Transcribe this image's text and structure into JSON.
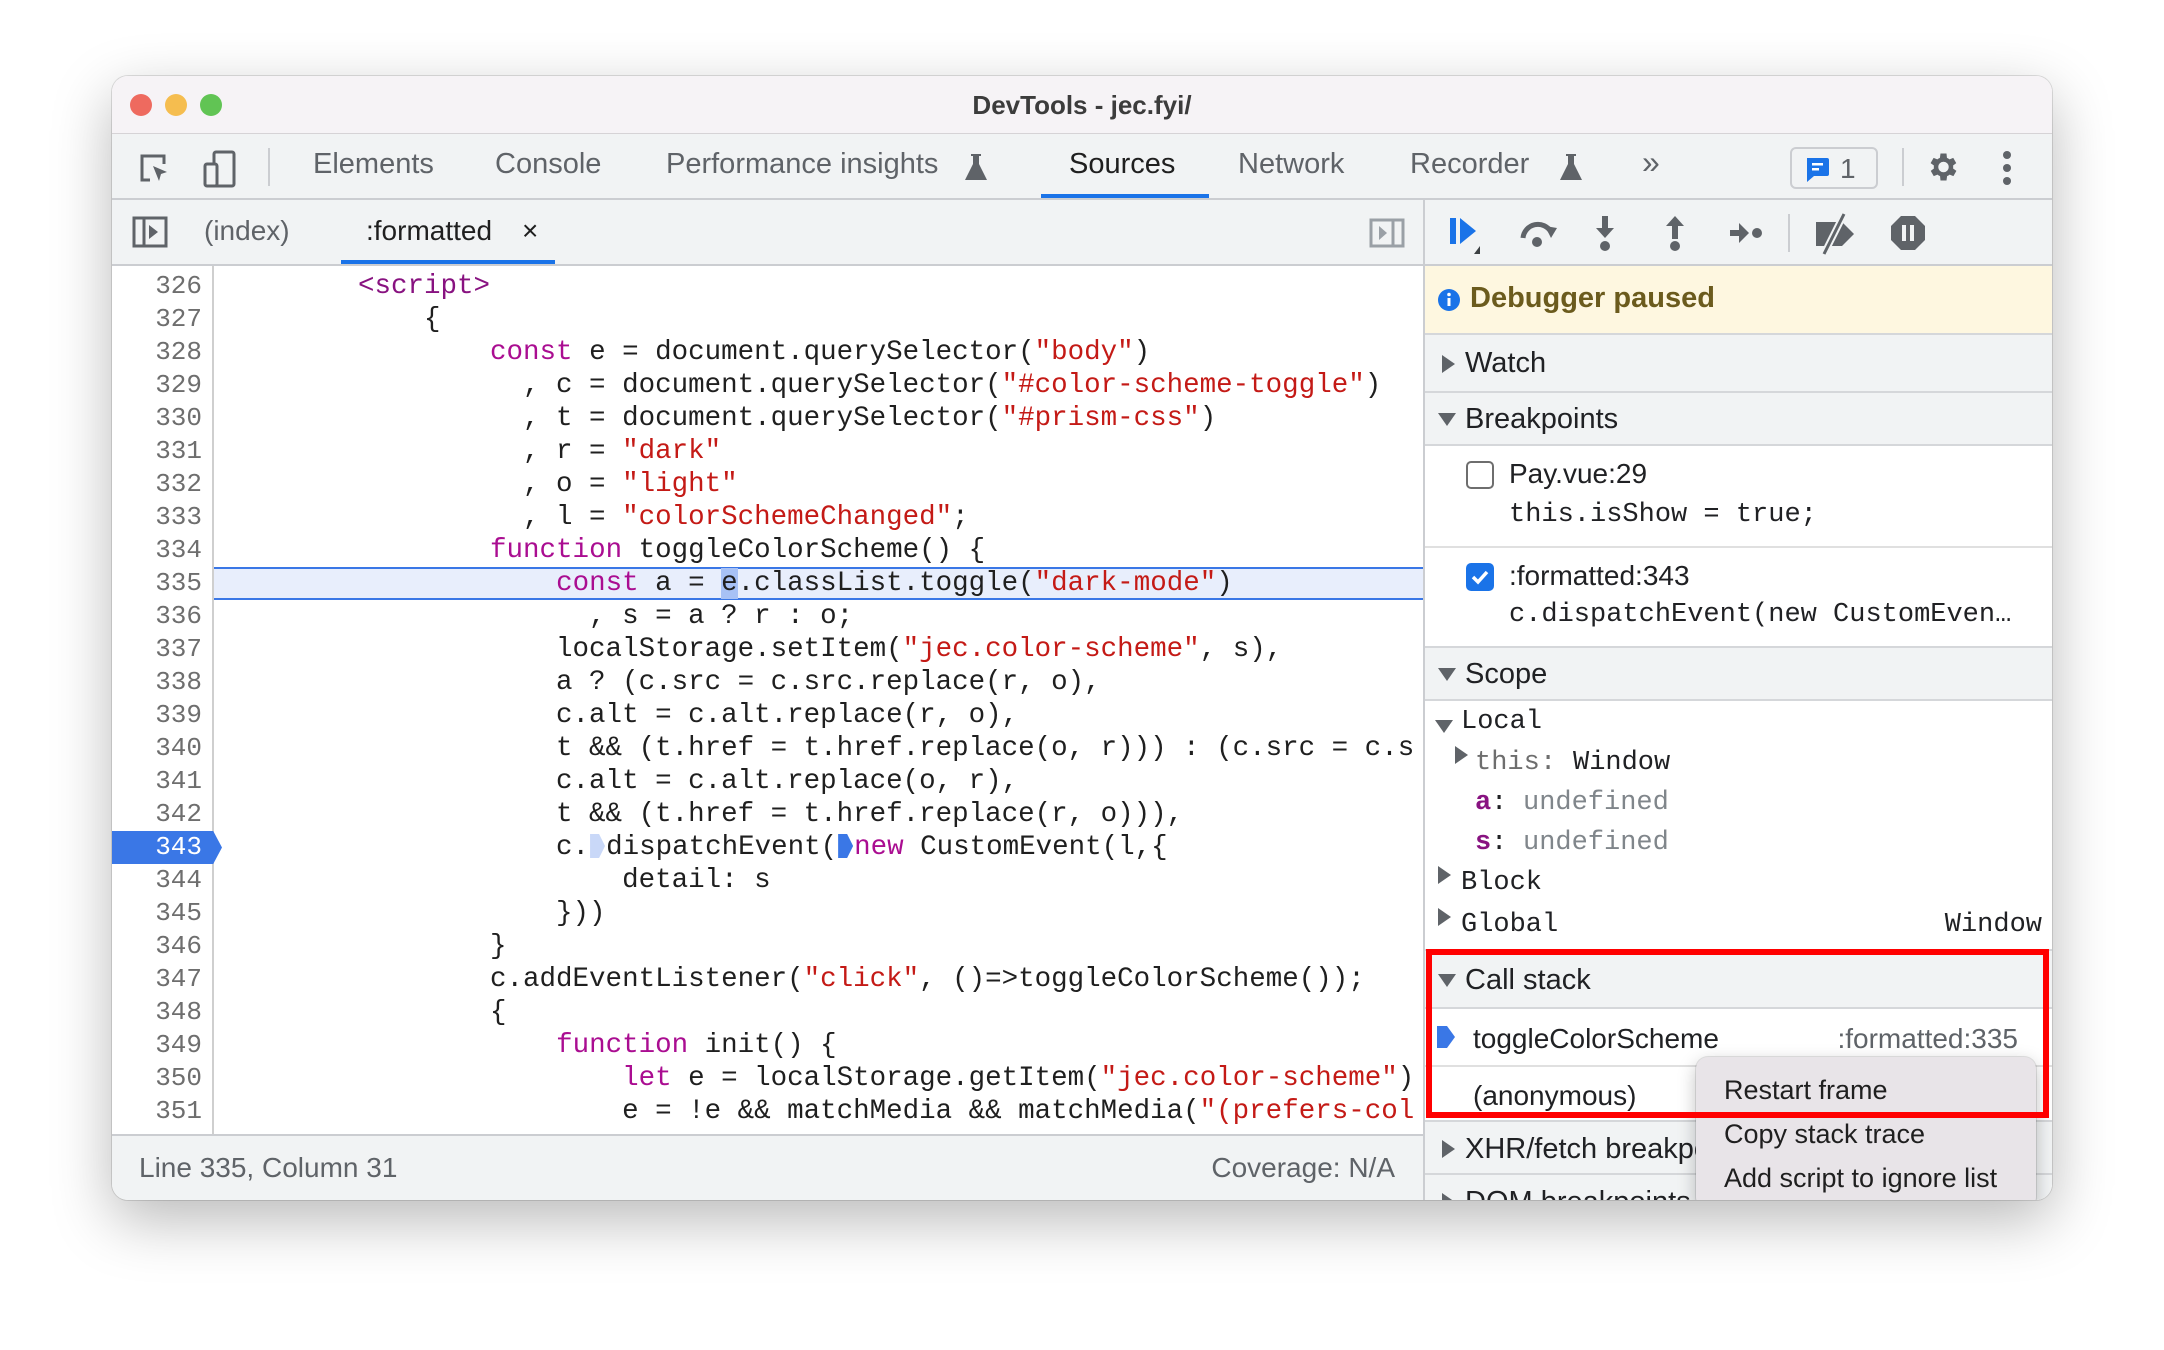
{
  "window": {
    "title": "DevTools - jec.fyi/"
  },
  "toolbar": {
    "tabs": [
      {
        "label": "Elements"
      },
      {
        "label": "Console"
      },
      {
        "label": "Performance insights",
        "icon": "flask-icon"
      },
      {
        "label": "Sources",
        "active": true
      },
      {
        "label": "Network"
      },
      {
        "label": "Recorder",
        "icon": "flask-icon"
      }
    ],
    "more_tabs": "»",
    "issues_count": "1"
  },
  "file_tabs": {
    "items": [
      {
        "label": "(index)"
      },
      {
        "label": ":formatted",
        "active": true
      }
    ],
    "close": "×"
  },
  "editor": {
    "current_line": 335,
    "paused_line": 343,
    "lines": [
      {
        "num": "326",
        "tokens": [
          [
            "t",
            "        "
          ],
          [
            "tg",
            "<script>"
          ]
        ]
      },
      {
        "num": "327",
        "tokens": [
          [
            "t",
            "            {"
          ]
        ]
      },
      {
        "num": "328",
        "tokens": [
          [
            "t",
            "                "
          ],
          [
            "k",
            "const"
          ],
          [
            "t",
            " e = document.querySelector("
          ],
          [
            "s",
            "\"body\""
          ],
          [
            "t",
            ")"
          ]
        ]
      },
      {
        "num": "329",
        "tokens": [
          [
            "t",
            "                  , c = document.querySelector("
          ],
          [
            "s",
            "\"#color-scheme-toggle\""
          ],
          [
            "t",
            ")"
          ]
        ]
      },
      {
        "num": "330",
        "tokens": [
          [
            "t",
            "                  , t = document.querySelector("
          ],
          [
            "s",
            "\"#prism-css\""
          ],
          [
            "t",
            ")"
          ]
        ]
      },
      {
        "num": "331",
        "tokens": [
          [
            "t",
            "                  , r = "
          ],
          [
            "s",
            "\"dark\""
          ]
        ]
      },
      {
        "num": "332",
        "tokens": [
          [
            "t",
            "                  , o = "
          ],
          [
            "s",
            "\"light\""
          ]
        ]
      },
      {
        "num": "333",
        "tokens": [
          [
            "t",
            "                  , l = "
          ],
          [
            "s",
            "\"colorSchemeChanged\""
          ],
          [
            "t",
            ";"
          ]
        ]
      },
      {
        "num": "334",
        "tokens": [
          [
            "t",
            "                "
          ],
          [
            "k",
            "function"
          ],
          [
            "t",
            " toggleColorScheme() {"
          ]
        ]
      },
      {
        "num": "335",
        "tokens": [
          [
            "t",
            "                    "
          ],
          [
            "k",
            "const"
          ],
          [
            "t",
            " a = "
          ],
          [
            "sel",
            "e"
          ],
          [
            "t",
            ".classList.toggle("
          ],
          [
            "s",
            "\"dark-mode\""
          ],
          [
            "t",
            ")"
          ]
        ]
      },
      {
        "num": "336",
        "tokens": [
          [
            "t",
            "                      , s = a ? r : o;"
          ]
        ]
      },
      {
        "num": "337",
        "tokens": [
          [
            "t",
            "                    localStorage.setItem("
          ],
          [
            "s",
            "\"jec.color-scheme\""
          ],
          [
            "t",
            ", s),"
          ]
        ]
      },
      {
        "num": "338",
        "tokens": [
          [
            "t",
            "                    a ? (c.src = c.src.replace(r, o),"
          ]
        ]
      },
      {
        "num": "339",
        "tokens": [
          [
            "t",
            "                    c.alt = c.alt.replace(r, o),"
          ]
        ]
      },
      {
        "num": "340",
        "tokens": [
          [
            "t",
            "                    t && (t.href = t.href.replace(o, r))) : (c.src = c.s"
          ]
        ]
      },
      {
        "num": "341",
        "tokens": [
          [
            "t",
            "                    c.alt = c.alt.replace(o, r),"
          ]
        ]
      },
      {
        "num": "342",
        "tokens": [
          [
            "t",
            "                    t && (t.href = t.href.replace(r, o))),"
          ]
        ]
      },
      {
        "num": "343",
        "tokens": [
          [
            "t",
            "                    c."
          ],
          [
            "m-off",
            ""
          ],
          [
            "t",
            "dispatchEvent("
          ],
          [
            "m-on",
            ""
          ],
          [
            "k",
            "new"
          ],
          [
            "t",
            " CustomEvent(l,{"
          ]
        ]
      },
      {
        "num": "344",
        "tokens": [
          [
            "t",
            "                        detail: s"
          ]
        ]
      },
      {
        "num": "345",
        "tokens": [
          [
            "t",
            "                    }))"
          ]
        ]
      },
      {
        "num": "346",
        "tokens": [
          [
            "t",
            "                }"
          ]
        ]
      },
      {
        "num": "347",
        "tokens": [
          [
            "t",
            "                c.addEventListener("
          ],
          [
            "s",
            "\"click\""
          ],
          [
            "t",
            ", ()=>toggleColorScheme());"
          ]
        ]
      },
      {
        "num": "348",
        "tokens": [
          [
            "t",
            "                {"
          ]
        ]
      },
      {
        "num": "349",
        "tokens": [
          [
            "t",
            "                    "
          ],
          [
            "k",
            "function"
          ],
          [
            "t",
            " init() {"
          ]
        ]
      },
      {
        "num": "350",
        "tokens": [
          [
            "t",
            "                        "
          ],
          [
            "k",
            "let"
          ],
          [
            "t",
            " e = localStorage.getItem("
          ],
          [
            "s",
            "\"jec.color-scheme\""
          ],
          [
            "t",
            ")"
          ]
        ]
      },
      {
        "num": "351",
        "tokens": [
          [
            "t",
            "                        e = !e && matchMedia && matchMedia("
          ],
          [
            "s",
            "\"(prefers-col"
          ]
        ]
      }
    ]
  },
  "status": {
    "position": "Line 335, Column 31",
    "coverage": "Coverage: N/A"
  },
  "debugger": {
    "banner": "Debugger paused",
    "watch": "Watch",
    "breakpoints": {
      "title": "Breakpoints",
      "items": [
        {
          "location": "Pay.vue:29",
          "code": "this.isShow = true;",
          "checked": false
        },
        {
          "location": ":formatted:343",
          "code": "c.dispatchEvent(new CustomEven…",
          "checked": true
        }
      ]
    },
    "scope": {
      "title": "Scope",
      "local": "Local",
      "this_key": "this",
      "this_val": "Window",
      "vars": [
        {
          "key": "a",
          "val": "undefined"
        },
        {
          "key": "s",
          "val": "undefined"
        }
      ],
      "block": "Block",
      "global": "Global",
      "global_val": "Window"
    },
    "call_stack": {
      "title": "Call stack",
      "frames": [
        {
          "name": "toggleColorScheme",
          "location": ":formatted:335",
          "current": true
        },
        {
          "name": "(anonymous)",
          "location": ""
        }
      ]
    },
    "xhr": "XHR/fetch breakpoints",
    "dom": "DOM breakpoints"
  },
  "context_menu": {
    "items": [
      "Restart frame",
      "Copy stack trace",
      "Add script to ignore list"
    ]
  },
  "colors": {
    "accent": "#1a73e8",
    "highlight_box": "#ff0000",
    "keyword": "#aa0d91",
    "string": "#c41a16",
    "banner_bg": "#fef7e0"
  }
}
